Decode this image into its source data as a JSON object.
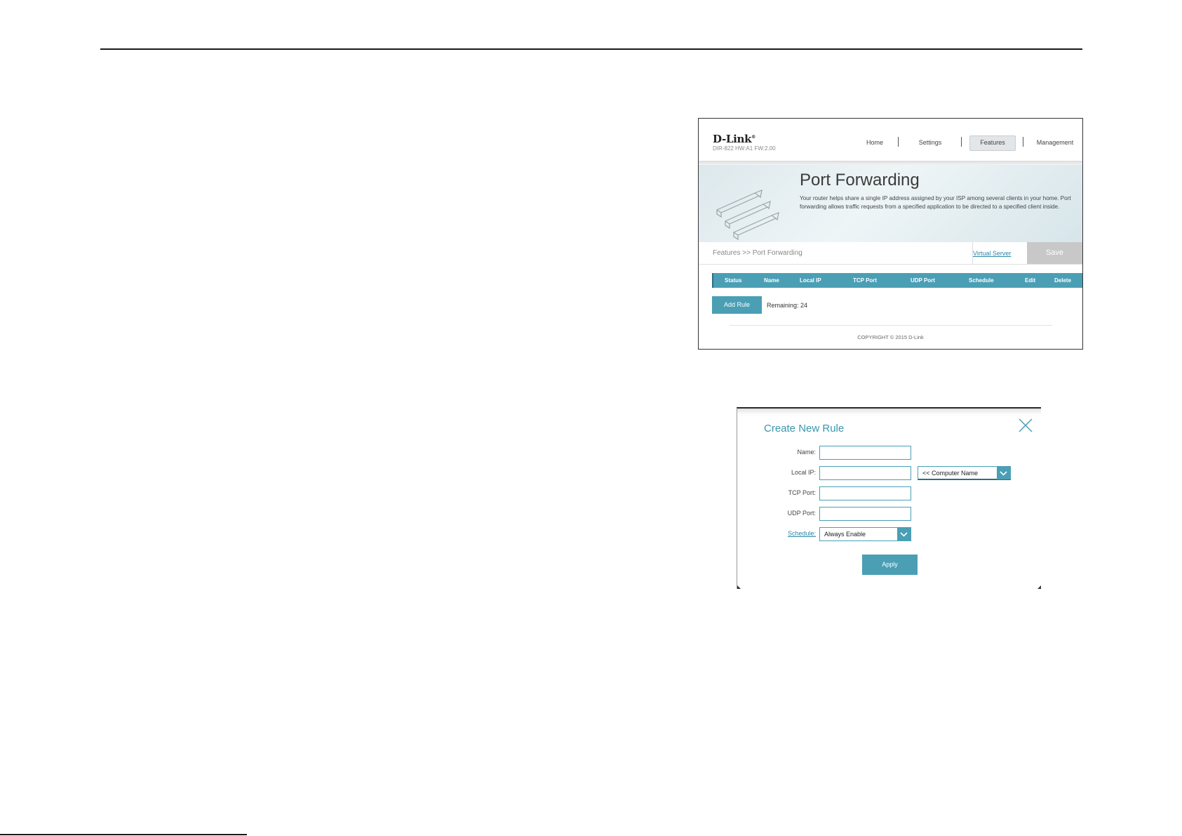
{
  "router_page": {
    "brand": "D-Link",
    "model": "DIR-822 HW:A1 FW:2.00",
    "nav": [
      "Home",
      "Settings",
      "Features",
      "Management"
    ],
    "active_nav": "Features",
    "title": "Port Forwarding",
    "description": "Your router helps share a single IP address assigned by your ISP among several clients in your home. Port forwarding allows traffic requests from a specified application to be directed to a specified client inside.",
    "breadcrumb": "Features >> Port Forwarding",
    "virtual_server_link": "Virtual Server",
    "save_label": "Save",
    "table_columns": [
      "Status",
      "Name",
      "Local IP",
      "TCP Port",
      "UDP Port",
      "Schedule",
      "Edit",
      "Delete"
    ],
    "add_rule_label": "Add Rule",
    "remaining": "Remaining: 24",
    "copyright": "COPYRIGHT © 2015 D-Link"
  },
  "modal": {
    "title": "Create New Rule",
    "labels": {
      "name": "Name:",
      "local_ip": "Local IP:",
      "tcp_port": "TCP Port:",
      "udp_port": "UDP Port:",
      "schedule": "Schedule:"
    },
    "values": {
      "name": "",
      "local_ip": "",
      "tcp_port": "",
      "udp_port": ""
    },
    "computer_name_select": "<< Computer Name",
    "schedule_select": "Always Enable",
    "apply_label": "Apply"
  },
  "colors": {
    "accent": "#4a9fb5",
    "save_disabled": "#c8c8c8"
  }
}
